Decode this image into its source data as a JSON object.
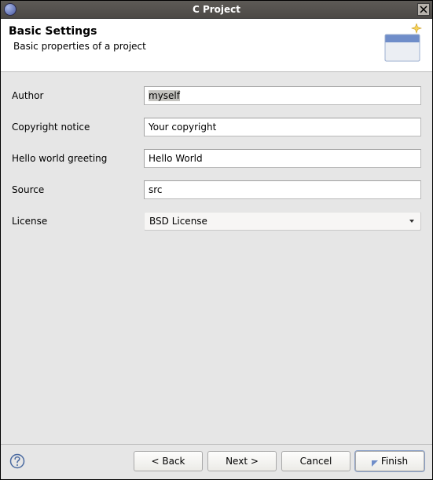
{
  "window": {
    "title": "C Project"
  },
  "header": {
    "title": "Basic Settings",
    "description": "Basic properties of a project"
  },
  "form": {
    "author": {
      "label": "Author",
      "value": "myself"
    },
    "copyright": {
      "label": "Copyright notice",
      "value": "Your copyright"
    },
    "greeting": {
      "label": "Hello world greeting",
      "value": "Hello World"
    },
    "source": {
      "label": "Source",
      "value": "src"
    },
    "license": {
      "label": "License",
      "value": "BSD License"
    }
  },
  "buttons": {
    "back": "< Back",
    "next": "Next >",
    "cancel": "Cancel",
    "finish": "Finish"
  }
}
